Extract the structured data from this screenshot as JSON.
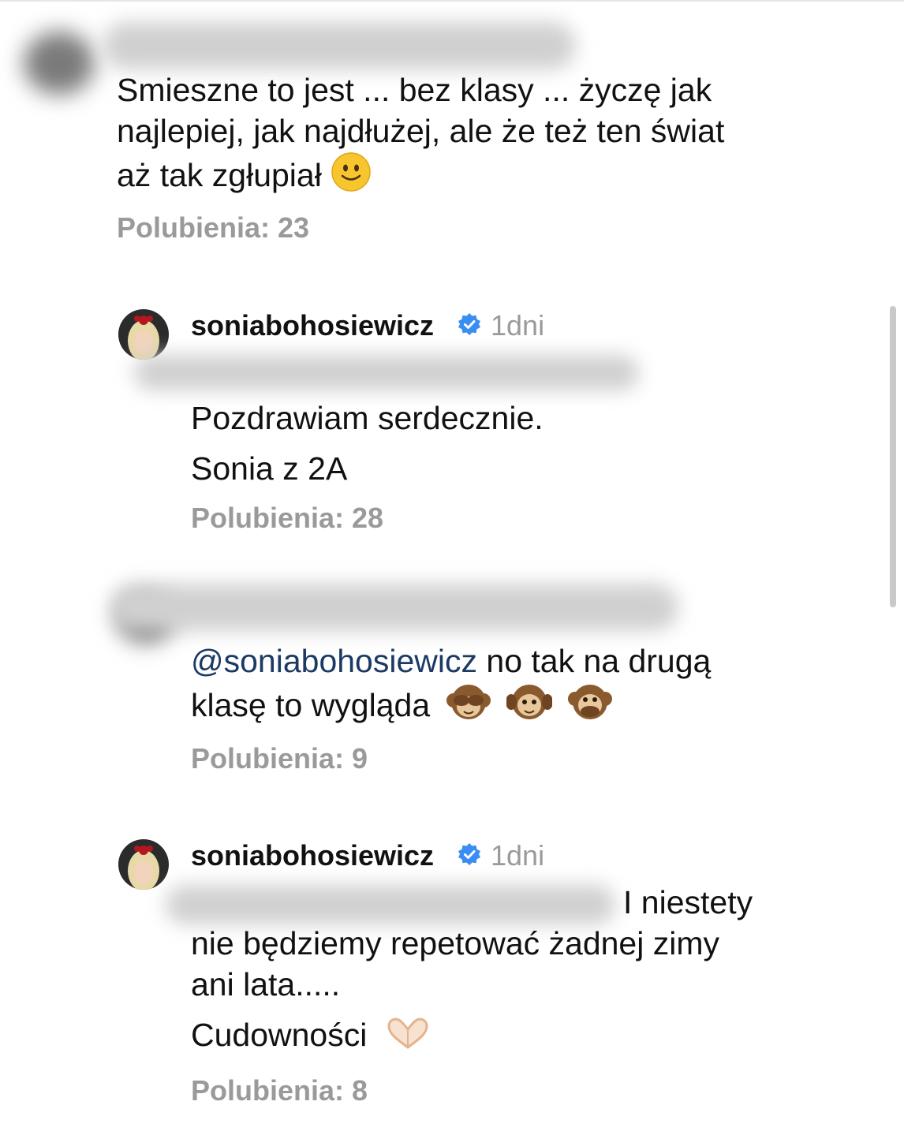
{
  "comments": [
    {
      "text_lines": [
        "Smieszne to jest ... bez klasy ... życzę jak",
        "najlepiej, jak najdłużej, ale że też ten świat",
        "aż tak zgłupiał"
      ],
      "likes": "Polubienia: 23"
    },
    {
      "username": "soniabohosiewicz",
      "time": "1dni",
      "text_lines": [
        "Pozdrawiam serdecznie.",
        "Sonia z 2A"
      ],
      "likes": "Polubienia: 28"
    },
    {
      "mention": "@soniabohosiewicz",
      "text_lines": [
        "no tak na drugą",
        "klasę to wygląda"
      ],
      "likes": "Polubienia: 9"
    },
    {
      "username": "soniabohosiewicz",
      "time": "1dni",
      "text_lines": [
        "I niestety",
        "nie będziemy repetować żadnej zimy",
        "ani lata.....",
        "Cudowności"
      ],
      "likes": "Polubienia: 8"
    }
  ],
  "icons": {
    "verified": "verified-badge-icon",
    "smile": "slightly-smiling-face-icon",
    "monkeys": [
      "see-no-evil-monkey-icon",
      "hear-no-evil-monkey-icon",
      "speak-no-evil-monkey-icon"
    ],
    "heart_hands": "heart-hands-icon"
  },
  "colors": {
    "text": "#111111",
    "muted": "#9a9a9a",
    "mention": "#1b3a64",
    "verified": "#3a8df2"
  }
}
